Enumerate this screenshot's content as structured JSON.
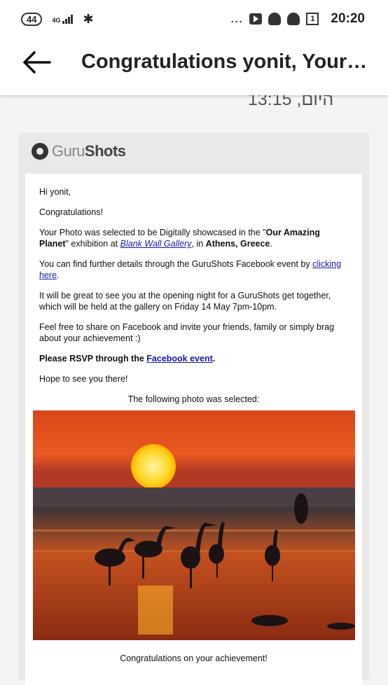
{
  "status": {
    "battery": "44",
    "network": "4G",
    "dots": "...",
    "calendar_day": "1",
    "time": "20:20"
  },
  "header": {
    "title": "Congratulations yonit, Your ..."
  },
  "cut_text": "היום, 13:15",
  "logo": {
    "part1": "Guru",
    "part2": "Shots"
  },
  "email": {
    "greeting": "Hi yonit,",
    "congrats": "Congratulations!",
    "p1_a": "Your Photo was selected to be Digitally showcased in the \"",
    "p1_b": "Our Amazing Planet",
    "p1_c": "\" exhibition at ",
    "p1_link": "Blank Wall Gallery",
    "p1_d": ", in ",
    "p1_e": "Athens, Greece",
    "p1_f": ".",
    "p2_a": "You can find further details through the GuruShots Facebook event by ",
    "p2_link": "clicking here",
    "p2_b": ".",
    "p3": "It will be great to see you at the opening night for a GuruShots get together, which will be held at the gallery on Friday 14 May 7pm-10pm.",
    "p4": "Feel free to share on Facebook and invite your friends, family or simply brag about your achievement :)",
    "p5_a": "Please RSVP through the ",
    "p5_link": "Facebook event",
    "p5_b": ".",
    "p6": "Hope to see you there!",
    "p7": "The following photo was selected:",
    "caption": "Congratulations on your achievement!"
  }
}
